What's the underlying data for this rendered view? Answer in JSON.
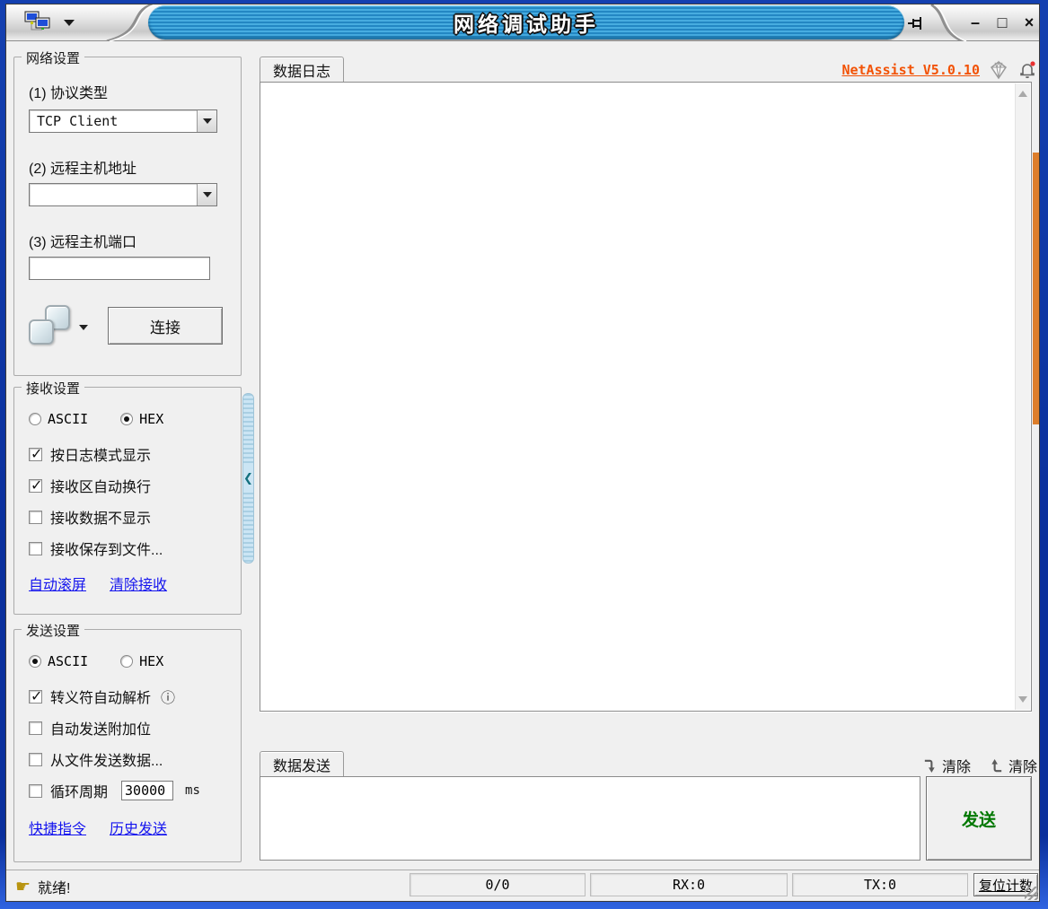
{
  "titlebar": {
    "title": "网络调试助手",
    "minimize": "–",
    "maximize": "□",
    "close": "×"
  },
  "network_settings": {
    "title": "网络设置",
    "protocol_label": "(1) 协议类型",
    "protocol_value": "TCP Client",
    "host_label": "(2) 远程主机地址",
    "host_value": "",
    "port_label": "(3) 远程主机端口",
    "port_value": "",
    "connect_label": "连接"
  },
  "receive_settings": {
    "title": "接收设置",
    "ascii": {
      "label": "ASCII",
      "selected": false
    },
    "hex": {
      "label": "HEX",
      "selected": true
    },
    "checkboxes": [
      {
        "label": "按日志模式显示",
        "checked": true
      },
      {
        "label": "接收区自动换行",
        "checked": true
      },
      {
        "label": "接收数据不显示",
        "checked": false
      },
      {
        "label": "接收保存到文件...",
        "checked": false
      }
    ],
    "link_autoscroll": "自动滚屏",
    "link_clear": "清除接收"
  },
  "send_settings": {
    "title": "发送设置",
    "ascii": {
      "label": "ASCII",
      "selected": true
    },
    "hex": {
      "label": "HEX",
      "selected": false
    },
    "checkboxes": [
      {
        "label": "转义符自动解析",
        "checked": true
      },
      {
        "label": "自动发送附加位",
        "checked": false
      },
      {
        "label": "从文件发送数据...",
        "checked": false
      },
      {
        "label": "循环周期",
        "checked": false
      }
    ],
    "info_glyph": "ⓘ",
    "cycle_value": "30000",
    "cycle_unit": "ms",
    "link_shortcut": "快捷指令",
    "link_history": "历史发送"
  },
  "log_panel": {
    "tab": "数据日志",
    "version_link": "NetAssist V5.0.10",
    "content": ""
  },
  "send_panel": {
    "tab": "数据发送",
    "clear_receive": "清除",
    "clear_send": "清除",
    "send_button": "发送",
    "input": ""
  },
  "statusbar": {
    "ready": "就绪!",
    "count": "0/0",
    "rx": "RX:0",
    "tx": "TX:0",
    "reset": "复位计数"
  },
  "icons": {
    "app": "network-icon",
    "pin": "pin-icon",
    "diamond": "diamond-icon",
    "bell": "bell-notification-icon",
    "hand": "☛",
    "splitter_chevron": "❮"
  },
  "colors": {
    "title_stripe_blue": "#2387C3",
    "frame_navy": "#0A2F9C",
    "link_blue": "#1414EE",
    "version_orange": "#F25205",
    "send_green": "#007800",
    "edge_accent_orange": "#DD7E2B"
  }
}
